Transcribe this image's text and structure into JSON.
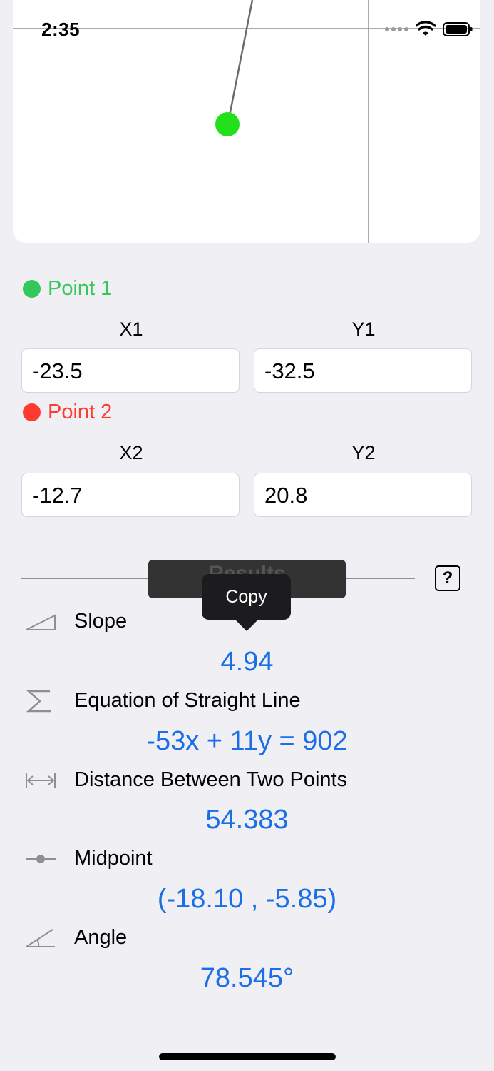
{
  "status_bar": {
    "time": "2:35"
  },
  "graph": {
    "point_color": "#22e11b",
    "line_color": "#6b6b6b",
    "axis_color": "#8e8e93"
  },
  "point1": {
    "title": "Point 1",
    "x_label": "X1",
    "y_label": "Y1",
    "x_value": "-23.5",
    "y_value": "-32.5",
    "color": "#34c759"
  },
  "point2": {
    "title": "Point 2",
    "x_label": "X2",
    "y_label": "Y2",
    "x_value": "-12.7",
    "y_value": "20.8",
    "color": "#ff3b30"
  },
  "results": {
    "button_label": "Results",
    "help_label": "?",
    "tooltip": "Copy",
    "items": [
      {
        "icon": "slope-icon",
        "label": "Slope",
        "value": "4.94"
      },
      {
        "icon": "sigma-icon",
        "label": "Equation of Straight Line",
        "value": "-53x + 11y = 902"
      },
      {
        "icon": "distance-icon",
        "label": "Distance Between Two Points",
        "value": "54.383"
      },
      {
        "icon": "midpoint-icon",
        "label": "Midpoint",
        "value": "(-18.10 , -5.85)"
      },
      {
        "icon": "angle-icon",
        "label": "Angle",
        "value": "78.545°"
      }
    ]
  }
}
